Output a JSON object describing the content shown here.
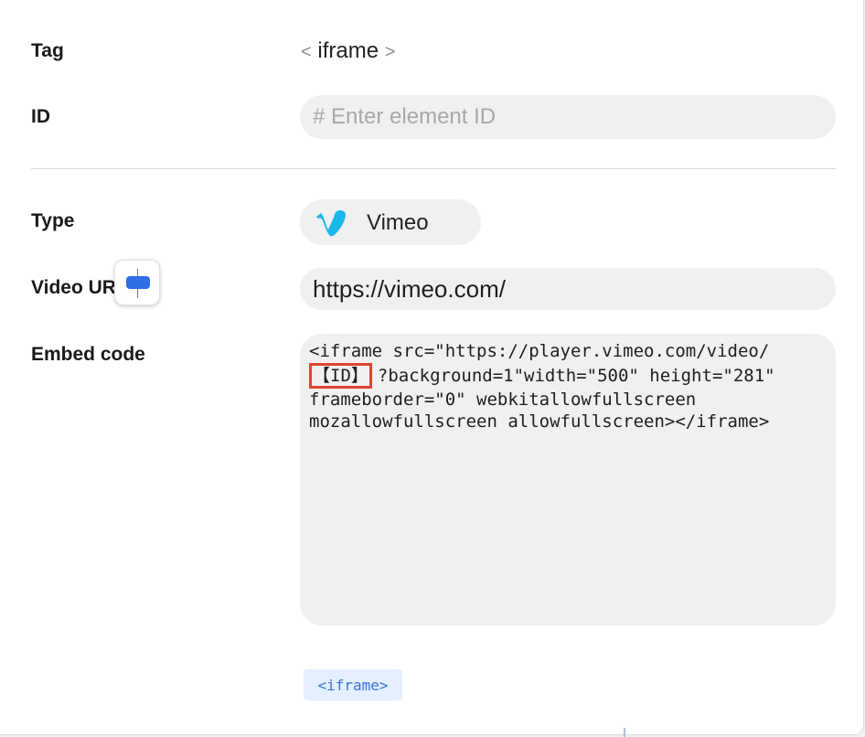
{
  "form": {
    "tag_label": "Tag",
    "tag_value": "iframe",
    "tag_bracket_open": "<",
    "tag_bracket_close": ">",
    "id_label": "ID",
    "id_placeholder": "# Enter element ID",
    "id_value": "",
    "type_label": "Type",
    "type_value": "Vimeo",
    "type_icon": "vimeo-logo-icon",
    "video_url_label": "Video URL",
    "video_url_value": "https://vimeo.com/",
    "embed_label": "Embed code",
    "embed_code": {
      "line1": "<iframe src=\"https://player.vimeo.com/video/",
      "highlight": "【ID】",
      "line2_rest": "?background=1\"width=\"500\" height=\"281\"",
      "line3": "frameborder=\"0\" webkitallowfullscreen",
      "line4": "mozallowfullscreen allowfullscreen></iframe>"
    },
    "tag_chip": "<iframe>"
  },
  "colors": {
    "highlight_border": "#e0442f",
    "chip_bg": "#e4efff",
    "chip_text": "#3b72d8",
    "vimeo_blue": "#1ab7ea",
    "handle_blue": "#2e6ee6"
  }
}
